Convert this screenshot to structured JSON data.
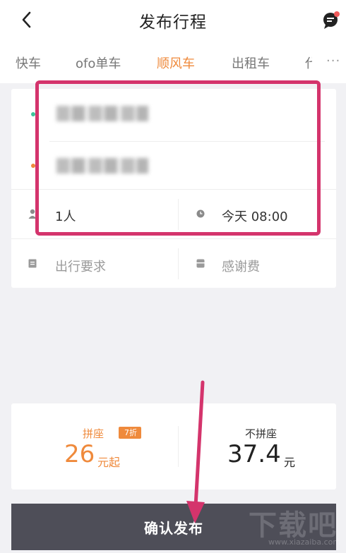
{
  "header": {
    "title": "发布行程"
  },
  "tabs": [
    {
      "label": "快车",
      "active": false
    },
    {
      "label": "ofo单车",
      "active": false
    },
    {
      "label": "顺风车",
      "active": true
    },
    {
      "label": "出租车",
      "active": false
    },
    {
      "label": "代",
      "active": false
    }
  ],
  "trip_form": {
    "passengers": "1人",
    "time": "今天 08:00",
    "requirements_placeholder": "出行要求",
    "thank_fee_placeholder": "感谢费"
  },
  "pricing": {
    "carpool_label": "拼座",
    "carpool_discount": "7折",
    "carpool_price": "26",
    "carpool_unit": "元起",
    "solo_label": "不拼座",
    "solo_price": "37.4",
    "solo_unit": "元"
  },
  "confirm_label": "确认发布",
  "watermark": {
    "text": "下载吧",
    "url": "www.xiazaiba.com"
  },
  "colors": {
    "accent": "#ef8a3c",
    "highlight": "#d4346c",
    "start_dot": "#3cc49a",
    "end_dot": "#ef8a3c",
    "button_bg": "#4e4e58",
    "notification": "#f05a5a"
  }
}
